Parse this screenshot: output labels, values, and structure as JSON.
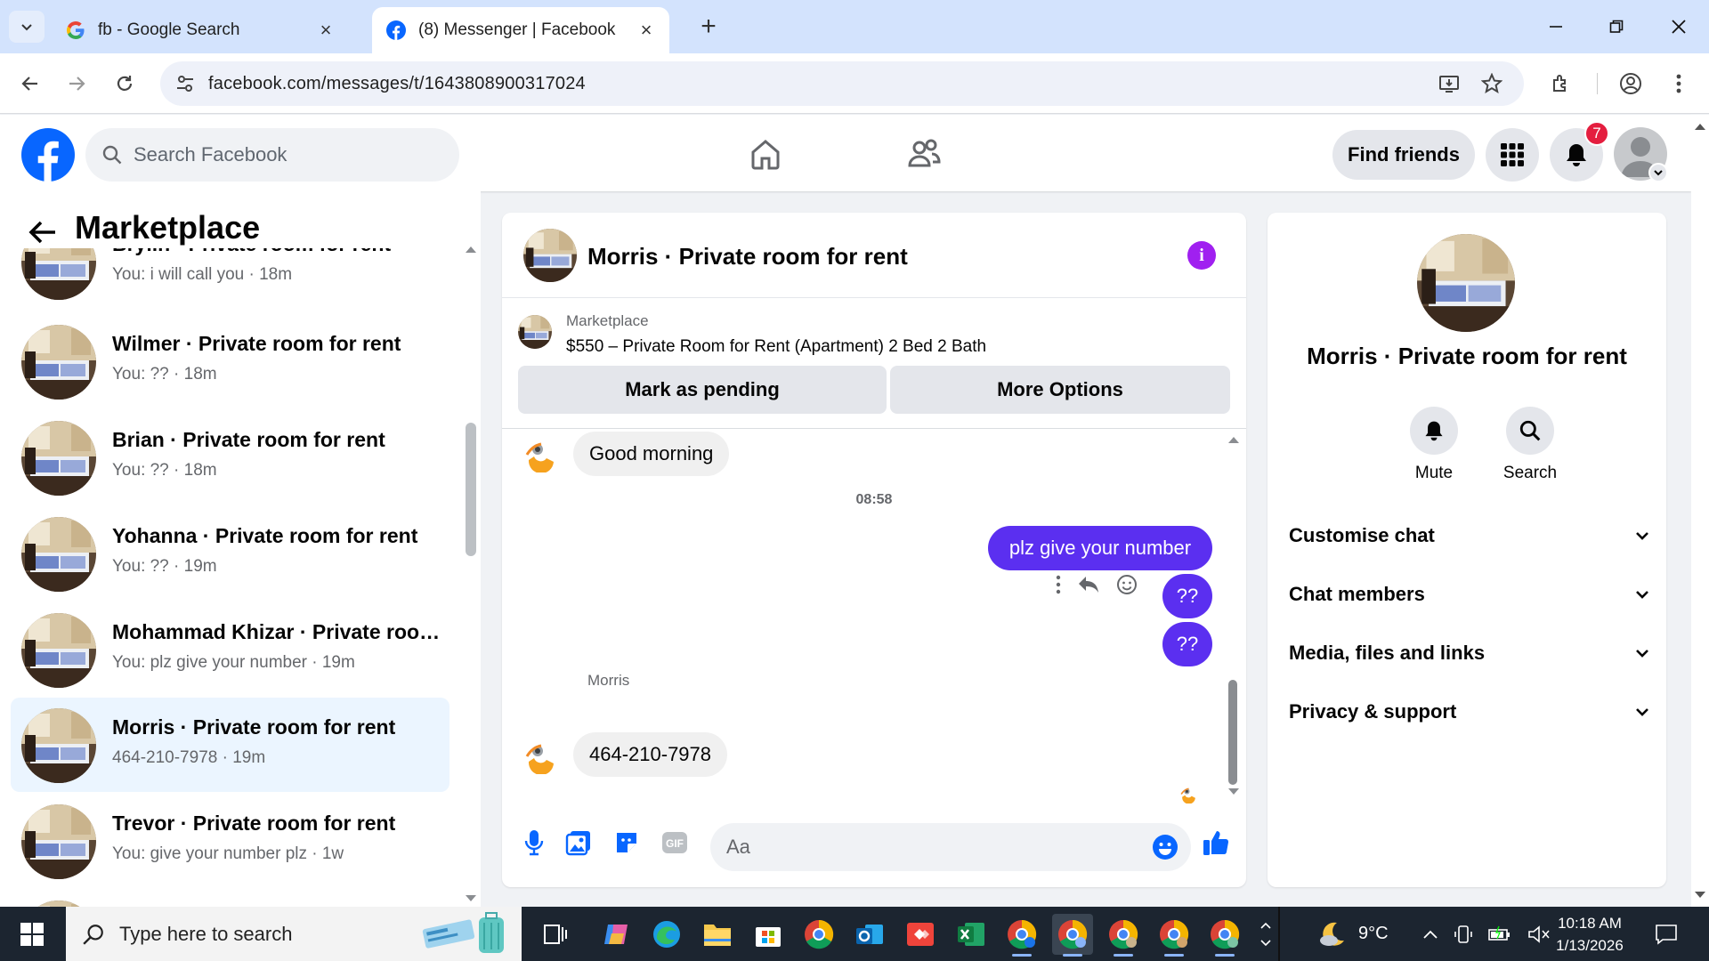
{
  "browser": {
    "tabs": [
      {
        "title": "fb - Google Search",
        "favicon": "google-icon",
        "active": false
      },
      {
        "title": "(8) Messenger | Facebook",
        "favicon": "facebook-icon",
        "active": true
      }
    ],
    "url": "facebook.com/messages/t/1643808900317024"
  },
  "fb_header": {
    "search_placeholder": "Search Facebook",
    "find_friends": "Find friends",
    "notification_count": "7"
  },
  "left_panel": {
    "title": "Marketplace",
    "conversations": [
      {
        "name": "Brylin · Private room for rent",
        "preview": "You: i will call you · 18m",
        "active": false
      },
      {
        "name": "Wilmer · Private room for rent",
        "preview": "You: ?? · 18m",
        "active": false
      },
      {
        "name": "Brian · Private room for rent",
        "preview": "You: ?? · 18m",
        "active": false
      },
      {
        "name": "Yohanna · Private room for rent",
        "preview": "You: ?? · 19m",
        "active": false
      },
      {
        "name": "Mohammad Khizar · Private room for rent",
        "preview": "You: plz give your number · 19m",
        "active": false
      },
      {
        "name": "Morris · Private room for rent",
        "preview": "464-210-7978 · 19m",
        "active": true
      },
      {
        "name": "Trevor · Private room for rent",
        "preview": "You: give your number plz · 1w",
        "active": false
      }
    ]
  },
  "chat": {
    "title": "Morris · Private room for rent",
    "marketplace_label": "Marketplace",
    "listing": "$550 – Private Room for Rent (Apartment) 2 Bed 2 Bath",
    "mark_pending": "Mark as pending",
    "more_options": "More Options",
    "messages": {
      "m1": "Good morning",
      "time": "08:58",
      "m2": "plz give your number",
      "m3": "??",
      "m4": "??",
      "sender": "Morris",
      "m5": "464-210-7978"
    },
    "composer_placeholder": "Aa"
  },
  "right_panel": {
    "name": "Morris · Private room for rent",
    "mute": "Mute",
    "search": "Search",
    "sections": [
      "Customise chat",
      "Chat members",
      "Media, files and links",
      "Privacy & support"
    ]
  },
  "taskbar": {
    "search_placeholder": "Type here to search",
    "temperature": "9°C",
    "time": "10:18 AM",
    "date": "1/13/2026"
  },
  "colors": {
    "fb_blue": "#0866ff",
    "outgoing_bubble": "#5b2ff0",
    "active_conv": "#ebf5ff",
    "info_purple": "#a020f0"
  }
}
